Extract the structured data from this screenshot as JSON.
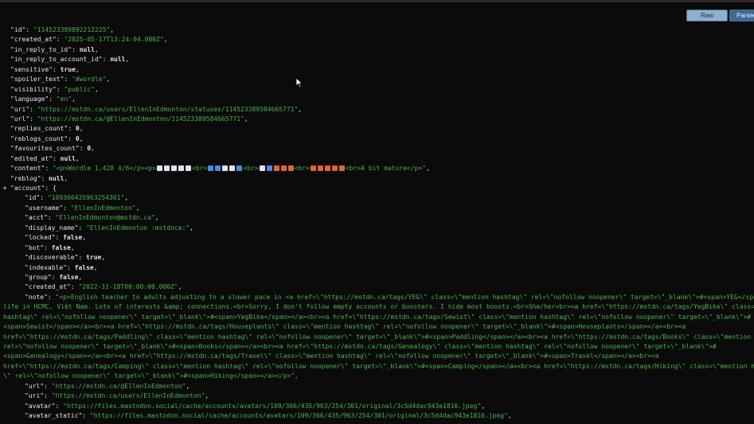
{
  "toolbar": {
    "raw_label": "Raw",
    "parsed_label": "Parsed"
  },
  "json": {
    "id": "114523389892212225",
    "created_at": "2025-05-17T13:24:04.000Z",
    "in_reply_to_id": "null",
    "in_reply_to_account_id": "null",
    "sensitive": "true",
    "spoiler_text": "#wordle",
    "visibility": "public",
    "language": "en",
    "uri": "https://mstdn.ca/users/EllenInEdmonton/statuses/114523389584665771",
    "url": "https://mstdn.ca/@EllenInEdmonton/114523389584665771",
    "replies_count": "0",
    "reblogs_count": "0",
    "favourites_count": "0",
    "edited_at": "null",
    "content_prefix": "<p>Wordle 1,428 4/6</p><p>",
    "content_br": "<br>",
    "content_suffix": "<br>A bit mature</p>",
    "reblog": "null",
    "account": {
      "id": "109366435963254301",
      "username": "EllenInEdmonton",
      "acct": "EllenInEdmonton@mstdn.ca",
      "display_name": "EllenInEdmonton :mstdnca:",
      "locked": "false",
      "bot": "false",
      "discoverable": "true",
      "indexable": "false",
      "group": "false",
      "created_at": "2022-11-18T00:00:00.000Z",
      "note_lines": [
        "\"<p>English teacher to adults adjusting to a slower pace in <a href=\\\"https://mstdn.ca/tags/YEG\\\" class=\\\"mention hashtag\\\" rel=\\\"nofollow noopener\\\" target=\\\"_blank\\\">#<span>YEG</span></a> after",
        "life in HCMC, Việt Nam. Lots of interests &amp; connections.<br>Sorry, I don't follow empty accounts or boosters. I hide most boosts.<br>She/her<br><a href=\\\"https://mstdn.ca/tags/YegBike\\\" class=\\\"mention",
        "hashtag\\\" rel=\\\"nofollow noopener\\\" target=\\\"_blank\\\">#<span>YegBike</span></a><br><a href=\\\"https://mstdn.ca/tags/Sewist\\\" class=\\\"mention hashtag\\\" rel=\\\"nofollow noopener\\\" target=\\\"_blank\\\">#",
        "<span>Sewist</span></a><br><a href=\\\"https://mstdn.ca/tags/Houseplants\\\" class=\\\"mention hashtag\\\" rel=\\\"nofollow noopener\\\" target=\\\"_blank\\\">#<span>Houseplants</span></a><br><a",
        "href=\\\"https://mstdn.ca/tags/Paddling\\\" class=\\\"mention hashtag\\\" rel=\\\"nofollow noopener\\\" target=\\\"_blank\\\">#<span>Paddling</span></a><br><a href=\\\"https://mstdn.ca/tags/Books\\\" class=\\\"mention hashtag\\\"",
        "rel=\\\"nofollow noopener\\\" target=\\\"_blank\\\">#<span>Books</span></a><br><a href=\\\"https://mstdn.ca/tags/Genealogy\\\" class=\\\"mention hashtag\\\" rel=\\\"nofollow noopener\\\" target=\\\"_blank\\\">#",
        "<span>Genealogy</span></a><br><a href=\\\"https://mstdn.ca/tags/Travel\\\" class=\\\"mention hashtag\\\" rel=\\\"nofollow noopener\\\" target=\\\"_blank\\\">#<span>Travel</span></a><br><a",
        "href=\\\"https://mstdn.ca/tags/Camping\\\" class=\\\"mention hashtag\\\" rel=\\\"nofollow noopener\\\" target=\\\"_blank\\\">#<span>Camping</span></a><br><a href=\\\"https://mstdn.ca/tags/Hiking\\\" class=\\\"mention hashtag",
        "\\\" rel=\\\"nofollow noopener\\\" target=\\\"_blank\\\">#<span>Hiking</span></a></p>\","
      ],
      "url": "https://mstdn.ca/@EllenInEdmonton",
      "uri": "https://mstdn.ca/users/EllenInEdmonton",
      "avatar": "https://files.mastodon.social/cache/accounts/avatars/109/366/435/963/254/301/original/3c5d4dac943e1816.jpeg",
      "avatar_static": "https://files.mastodon.social/cache/accounts/avatars/109/366/435/963/254/301/original/3c5d4dac943e1816.jpeg"
    }
  },
  "wordle_rows": [
    [
      "w",
      "w",
      "w",
      "w",
      "w"
    ],
    [
      "b",
      "b",
      "w",
      "w",
      "b"
    ],
    [
      "w",
      "b",
      "o",
      "o",
      "o"
    ],
    [
      "o",
      "o",
      "o",
      "o",
      "o"
    ]
  ],
  "colors": {
    "string": "#4bb34b",
    "background": "#0b0b0b",
    "button": "#8fb0cc"
  }
}
